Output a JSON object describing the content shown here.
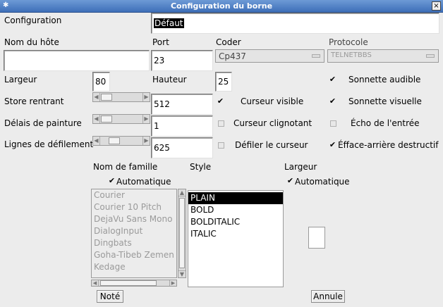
{
  "window": {
    "title": "Configuration du borne",
    "pin_glyph": "✱",
    "close_glyph": "×"
  },
  "config": {
    "label": "Configuration",
    "value": "Défaut"
  },
  "host": {
    "label": "Nom du hôte",
    "value": ""
  },
  "port": {
    "label": "Port",
    "value": "23"
  },
  "coder": {
    "label": "Coder",
    "value": "Cp437"
  },
  "protocol": {
    "label": "Protocole",
    "value": "TELNETBBS"
  },
  "width": {
    "label": "Largeur",
    "value": "80"
  },
  "height": {
    "label": "Hauteur",
    "value": "25"
  },
  "store": {
    "label": "Store rentrant",
    "value": "512"
  },
  "paint_delay": {
    "label": "Délais de painture",
    "value": "1"
  },
  "scroll_lines": {
    "label": "Lignes de défilement",
    "value": "625"
  },
  "options": {
    "bell_audible": {
      "label": "Sonnette audible",
      "checked": true
    },
    "bell_visual": {
      "label": "Sonnette visuelle",
      "checked": true
    },
    "cursor_visible": {
      "label": "Curseur visible",
      "checked": true
    },
    "cursor_blink": {
      "label": "Curseur clignotant",
      "checked": false
    },
    "echo_input": {
      "label": "Écho de l'entrée",
      "checked": false
    },
    "scroll_cursor": {
      "label": "Défiler le curseur",
      "checked": false
    },
    "destructive_bs": {
      "label": "Éfface-arrière destructif",
      "checked": true
    }
  },
  "check_glyph": "✔",
  "font": {
    "family_label": "Nom de famille",
    "style_label": "Style",
    "size_label": "Largeur",
    "family_auto": {
      "label": "Automatique",
      "checked": true
    },
    "size_auto": {
      "label": "Automatique",
      "checked": true
    },
    "families": [
      "Courier",
      "Courier 10 Pitch",
      "DejaVu Sans Mono",
      "DialogInput",
      "Dingbats",
      "Goha-Tibeb Zemen",
      "Kedage"
    ],
    "styles": [
      "PLAIN",
      "BOLD",
      "BOLDITALIC",
      "ITALIC"
    ],
    "selected_style": "PLAIN"
  },
  "buttons": {
    "ok": "Noté",
    "cancel": "Annule"
  },
  "arrows": {
    "left": "◀",
    "right": "▶",
    "up": "▲",
    "down": "▼"
  }
}
